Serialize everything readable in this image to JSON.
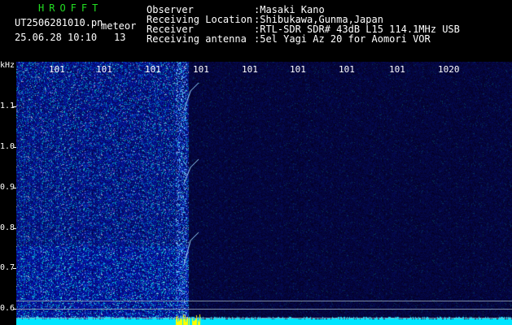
{
  "header": {
    "app_title": "HROFFT",
    "filename": "UT2506281010.pn",
    "mode": "meteor",
    "datetime": "25.06.28 10:10",
    "count": "13",
    "observer_label": "Observer",
    "observer_value": ":Masaki Kano",
    "location_label": "Receiving Location",
    "location_value": ":Shibukawa,Gunma,Japan",
    "receiver_label": "Receiver",
    "receiver_value": ":RTL-SDR SDR# 43dB L15 114.1MHz USB",
    "antenna_label": "Receiving antenna",
    "antenna_value": ":5el Yagi Az 20 for Aomori VOR"
  },
  "axis": {
    "y_unit": "kHz",
    "y_ticks": [
      "1.1",
      "1.0",
      "0.9",
      "0.8",
      "0.7",
      "0.6"
    ],
    "x_ticks": [
      "101",
      "101",
      "101",
      "101",
      "101",
      "101",
      "101",
      "101",
      "1020"
    ]
  },
  "colors": {
    "title": "#22dd22",
    "text": "#ffffff",
    "background": "#000000",
    "noise_base": "#0a1470",
    "bottom_band": "#00e5ff",
    "burst": "#ffff00"
  }
}
